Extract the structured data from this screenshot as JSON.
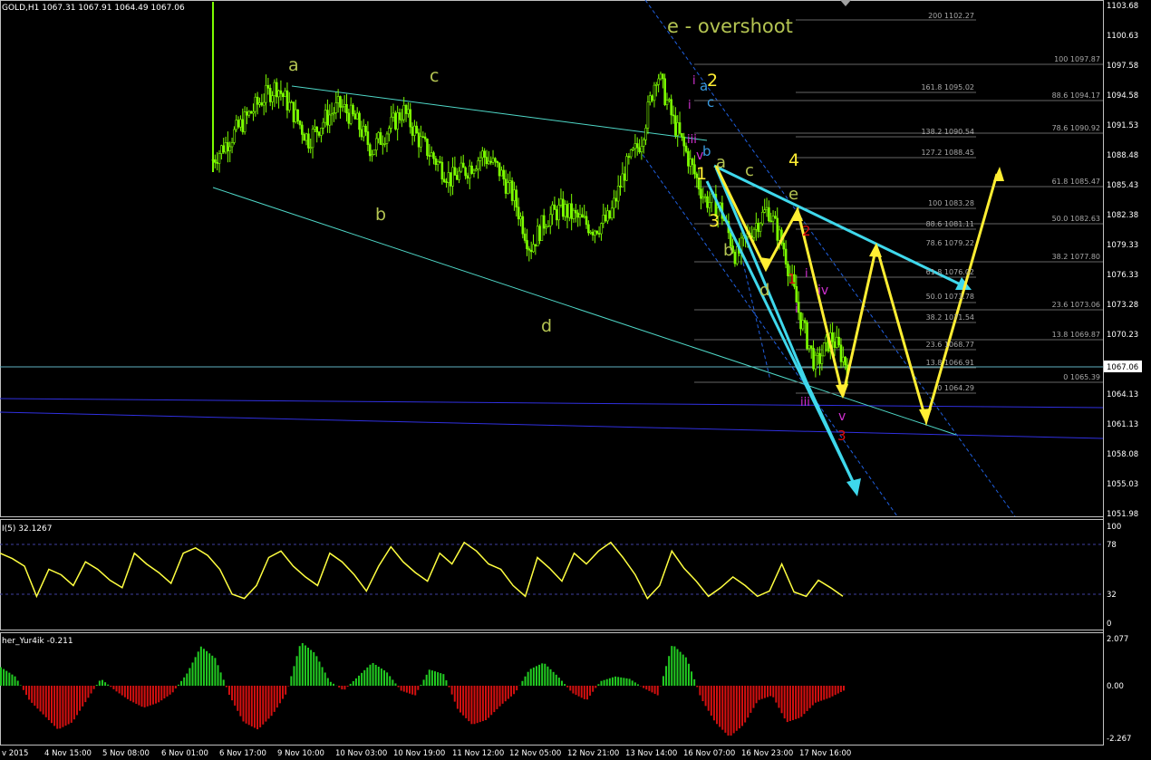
{
  "main_header": "GOLD,H1  1067.31 1067.91 1064.49 1067.06",
  "rsi_header": "I(5) 32.1267",
  "osc_header": "her_Yur4ik -0.211",
  "overshoot_label": "e - overshoot",
  "colors": {
    "background": "#000000",
    "bull_candle": "#7cfc00",
    "frame": "#c0c0c0",
    "fib": "#b0b0b0",
    "cyan": "#3fd8ec",
    "yellow": "#ffee33",
    "olive": "#b4c452",
    "magenta": "#d030d0",
    "red": "#e01010",
    "rsi_line": "#ffff40",
    "hist_up": "#22cc22",
    "hist_down": "#d41010"
  },
  "price_axis": [
    "1103.68",
    "1100.63",
    "1097.58",
    "1094.58",
    "1091.53",
    "1088.48",
    "1085.43",
    "1082.38",
    "1079.33",
    "1076.33",
    "1073.28",
    "1070.23",
    "1067.06",
    "1064.13",
    "1061.13",
    "1058.08",
    "1055.03",
    "1051.98"
  ],
  "rsi_axis": [
    "100",
    "78",
    "32",
    "0"
  ],
  "osc_axis": [
    "2.077",
    "0.00",
    "-2.267"
  ],
  "time_axis": [
    "v 2015",
    "4 Nov 15:00",
    "5 Nov 08:00",
    "6 Nov 01:00",
    "6 Nov 17:00",
    "9 Nov 10:00",
    "10 Nov 03:00",
    "10 Nov 19:00",
    "11 Nov 12:00",
    "12 Nov 05:00",
    "12 Nov 21:00",
    "13 Nov 14:00",
    "16 Nov 07:00",
    "16 Nov 23:00",
    "17 Nov 16:00"
  ],
  "fib_labels": [
    "200 1102.27",
    "100 1097.87",
    "161.8 1095.02",
    "88.6 1094.17",
    "78.6 1090.92",
    "138.2 1090.54",
    "127.2 1088.45",
    "61.8 1085.47",
    "100 1083.28",
    "50.0 1082.63",
    "88.6 1081.11",
    "78.6 1079.22",
    "38.2 1077.80",
    "61.8 1076.02",
    "23.6 1073.06",
    "50.0 1073.78",
    "38.2 1071.54",
    "13.8 1069.87",
    "23.6 1068.77",
    "13.8 1066.91",
    "0 1065.39",
    "0 1064.29"
  ],
  "wave_labels": {
    "big_a": "a",
    "big_b": "b",
    "big_c": "c",
    "big_d": "d",
    "y2": "2",
    "y1": "1",
    "y3": "3",
    "y4": "4",
    "s_a": "a",
    "s_b": "b",
    "s_c": "c",
    "s_d": "d",
    "s_e": "e",
    "m_i": "i",
    "m_iii": "iii",
    "m_v": "v",
    "m_iv": "iv",
    "m_i2": "i",
    "m_i3": "i",
    "m_iii2": "iii",
    "m_v2": "v",
    "r1": "1",
    "r2": "2",
    "r3": "3",
    "c_a": "a",
    "c_b": "b",
    "c_c": "c"
  },
  "chart_data": {
    "type": "candlestick",
    "symbol": "GOLD",
    "timeframe": "H1",
    "ohlc_last": {
      "open": 1067.31,
      "high": 1067.91,
      "low": 1064.49,
      "close": 1067.06
    },
    "ylim": [
      1051.98,
      1103.68
    ],
    "x": [
      "4 Nov 15:00",
      "5 Nov 08:00",
      "6 Nov 01:00",
      "6 Nov 17:00",
      "9 Nov 10:00",
      "10 Nov 03:00",
      "10 Nov 19:00",
      "11 Nov 12:00",
      "12 Nov 05:00",
      "12 Nov 21:00",
      "13 Nov 14:00",
      "16 Nov 07:00",
      "16 Nov 23:00",
      "17 Nov 16:00"
    ],
    "close_path": [
      1088,
      1090,
      1092,
      1094,
      1095.5,
      1093,
      1090,
      1092,
      1093.5,
      1092,
      1089,
      1091,
      1093,
      1090,
      1088,
      1086,
      1087,
      1088.5,
      1087,
      1084,
      1079,
      1082,
      1083,
      1082,
      1081,
      1082,
      1087,
      1090,
      1097,
      1092,
      1088,
      1084,
      1083,
      1078,
      1081,
      1083,
      1079,
      1072,
      1067,
      1070,
      1067
    ],
    "rsi": {
      "name": "I(5)",
      "last": 32.1267,
      "levels": [
        78,
        32
      ],
      "ylim": [
        0,
        100
      ],
      "values": [
        70,
        65,
        58,
        30,
        55,
        50,
        40,
        62,
        55,
        45,
        38,
        70,
        60,
        52,
        42,
        70,
        75,
        68,
        55,
        32,
        28,
        40,
        66,
        72,
        58,
        48,
        40,
        70,
        62,
        50,
        35,
        58,
        76,
        62,
        52,
        44,
        70,
        60,
        80,
        72,
        60,
        55,
        40,
        30,
        66,
        56,
        44,
        70,
        60,
        72,
        80,
        66,
        50,
        28,
        40,
        72,
        56,
        44,
        30,
        38,
        48,
        40,
        30,
        35,
        60,
        34,
        30,
        45,
        38,
        30
      ]
    },
    "oscillator": {
      "name": "her_Yur4ik",
      "last": -0.211,
      "ylim": [
        -2.267,
        2.077
      ],
      "values": [
        0.8,
        0.4,
        -0.6,
        -1.2,
        -1.8,
        -1.5,
        -0.6,
        0.3,
        -0.2,
        -0.6,
        -0.9,
        -0.7,
        -0.3,
        0.5,
        1.7,
        1.2,
        -0.4,
        -1.5,
        -1.8,
        -1.2,
        -0.3,
        1.9,
        1.4,
        0.2,
        -0.2,
        0.4,
        1.0,
        0.6,
        -0.2,
        -0.4,
        0.7,
        0.5,
        -1.0,
        -1.6,
        -1.4,
        -0.8,
        -0.3,
        0.7,
        1.0,
        0.4,
        -0.3,
        -0.6,
        0.2,
        0.4,
        0.3,
        -0.1,
        -0.4,
        1.8,
        1.2,
        -0.5,
        -1.5,
        -2.1,
        -1.6,
        -0.6,
        -0.4,
        -1.5,
        -1.3,
        -0.7,
        -0.5,
        -0.2
      ]
    }
  }
}
